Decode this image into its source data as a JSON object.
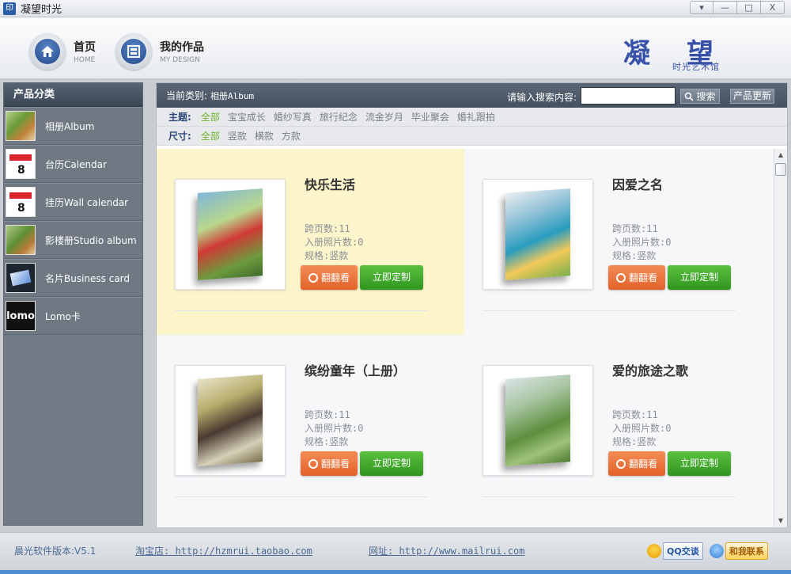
{
  "window": {
    "title": "凝望时光",
    "app_icon": "印",
    "controls": [
      "▾",
      "—",
      "□",
      "X"
    ]
  },
  "header": {
    "nav": [
      {
        "label": "首页",
        "sub": "HOME"
      },
      {
        "label": "我的作品",
        "sub": "MY DESIGN"
      }
    ],
    "logo_main": "凝望",
    "logo_sub": "时光艺术馆"
  },
  "sidebar": {
    "title": "产品分类",
    "items": [
      {
        "label": "相册Album",
        "thumb": "album"
      },
      {
        "label": "台历Calendar",
        "thumb": "calendar"
      },
      {
        "label": "挂历Wall calendar",
        "thumb": "calendar"
      },
      {
        "label": "影楼册Studio album",
        "thumb": "album"
      },
      {
        "label": "名片Business card",
        "thumb": "card"
      },
      {
        "label": "Lomo卡",
        "thumb": "lomo",
        "thumb_text": "lomo"
      }
    ]
  },
  "main": {
    "current_label": "当前类别:",
    "current_value": "相册Album",
    "search_label": "请输入搜索内容:",
    "search_value": "",
    "search_button": "搜索",
    "update_button": "产品更新",
    "filters": {
      "theme": {
        "label": "主题:",
        "options": [
          "全部",
          "宝宝成长",
          "婚纱写真",
          "旅行纪念",
          "流金岁月",
          "毕业聚会",
          "婚礼跟拍"
        ],
        "active": 0
      },
      "size": {
        "label": "尺寸:",
        "options": [
          "全部",
          "竖款",
          "横款",
          "方款"
        ],
        "active": 0
      }
    },
    "products": [
      {
        "title": "快乐生活",
        "pages": "跨页数:11",
        "photos": "入册照片数:0",
        "spec": "规格:竖款",
        "flip": "翻翻看",
        "custom": "立即定制",
        "highlight": true
      },
      {
        "title": "因爱之名",
        "pages": "跨页数:11",
        "photos": "入册照片数:0",
        "spec": "规格:竖款",
        "flip": "翻翻看",
        "custom": "立即定制",
        "highlight": false
      },
      {
        "title": "缤纷童年（上册）",
        "pages": "跨页数:11",
        "photos": "入册照片数:0",
        "spec": "规格:竖款",
        "flip": "翻翻看",
        "custom": "立即定制",
        "highlight": false
      },
      {
        "title": "爱的旅途之歌",
        "pages": "跨页数:11",
        "photos": "入册照片数:0",
        "spec": "规格:竖款",
        "flip": "翻翻看",
        "custom": "立即定制",
        "highlight": false
      }
    ]
  },
  "footer": {
    "version": "晨光软件版本:V5.1",
    "shop": "淘宝店: http://hzmrui.taobao.com",
    "site": "网址: http://www.mailrui.com",
    "qq": "QQ交谈",
    "contact": "和我联系"
  }
}
